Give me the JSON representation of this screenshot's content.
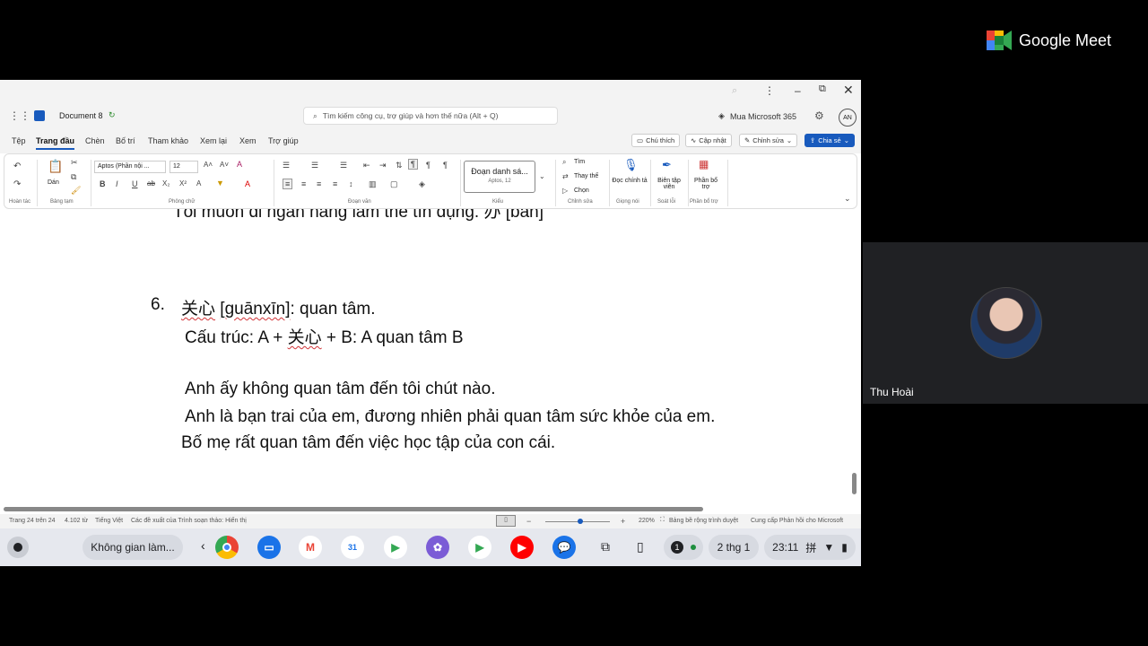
{
  "meet": {
    "brand": "Google Meet",
    "participant_name": "Thu Hoài"
  },
  "word": {
    "doc_title": "Document 8",
    "search_placeholder": "Tìm kiếm công cụ, trợ giúp và hơn thế nữa (Alt + Q)",
    "buy": "Mua Microsoft 365",
    "account_initials": "AN",
    "tabs": [
      "Tệp",
      "Trang đầu",
      "Chèn",
      "Bố trí",
      "Tham khảo",
      "Xem lại",
      "Xem",
      "Trợ giúp"
    ],
    "actions": {
      "comment": "Chú thích",
      "catch_up": "Cập nhật",
      "editing": "Chỉnh sửa",
      "share": "Chia sẻ"
    },
    "ribbon": {
      "undo_group": "Hoàn tác",
      "paste": "Dán",
      "clipboard_group": "Bảng tạm",
      "font_name": "Aptos (Phần nội ...",
      "font_size": "12",
      "font_group": "Phông chữ",
      "paragraph_group": "Đoạn văn",
      "style_name": "Đoạn danh sá...",
      "style_sub": "Aptos, 12",
      "styles_group": "Kiểu",
      "find": "Tìm",
      "replace": "Thay thế",
      "select": "Chọn",
      "editing_group": "Chỉnh sửa",
      "dictate": "Đọc chính tả",
      "voice_group": "Giọng nói",
      "editor": "Biên tập viên",
      "proofing_group": "Soát lỗi",
      "addins": "Phần bổ trợ",
      "addins_group": "Phần bổ trợ"
    },
    "document": {
      "cut_line": "Tôi muốn đi ngân hàng làm thẻ tín dụng. 办 [bàn]",
      "item_number": "6.",
      "item_hanzi": "关心",
      "item_pinyin": "[guānxīn]",
      "item_meaning": ": quan tâm.",
      "structure_pre": "Cấu trúc: A + ",
      "structure_hanzi": "关心",
      "structure_post": " + B: A quan tâm B",
      "ex1": "Anh ấy không quan tâm đến tôi chút nào.",
      "ex2": "Anh là bạn trai của em, đương nhiên phải quan tâm sức khỏe của em.",
      "ex3": "Bố mẹ rất quan tâm đến việc học tập của con cái."
    },
    "status": {
      "page": "Trang 24 trên 24",
      "words": "4.102 từ",
      "language": "Tiếng Việt",
      "suggestions": "Các đề xuất của Trình soạn thảo: Hiển thị",
      "zoom": "220%",
      "width": "Bảng bề rộng trình duyệt",
      "feedback": "Cung cấp Phản hồi cho Microsoft"
    }
  },
  "shelf": {
    "workspace": "Không gian làm...",
    "notif_count": "1",
    "date": "2 thg 1",
    "time": "23:11",
    "ime": "拼"
  }
}
